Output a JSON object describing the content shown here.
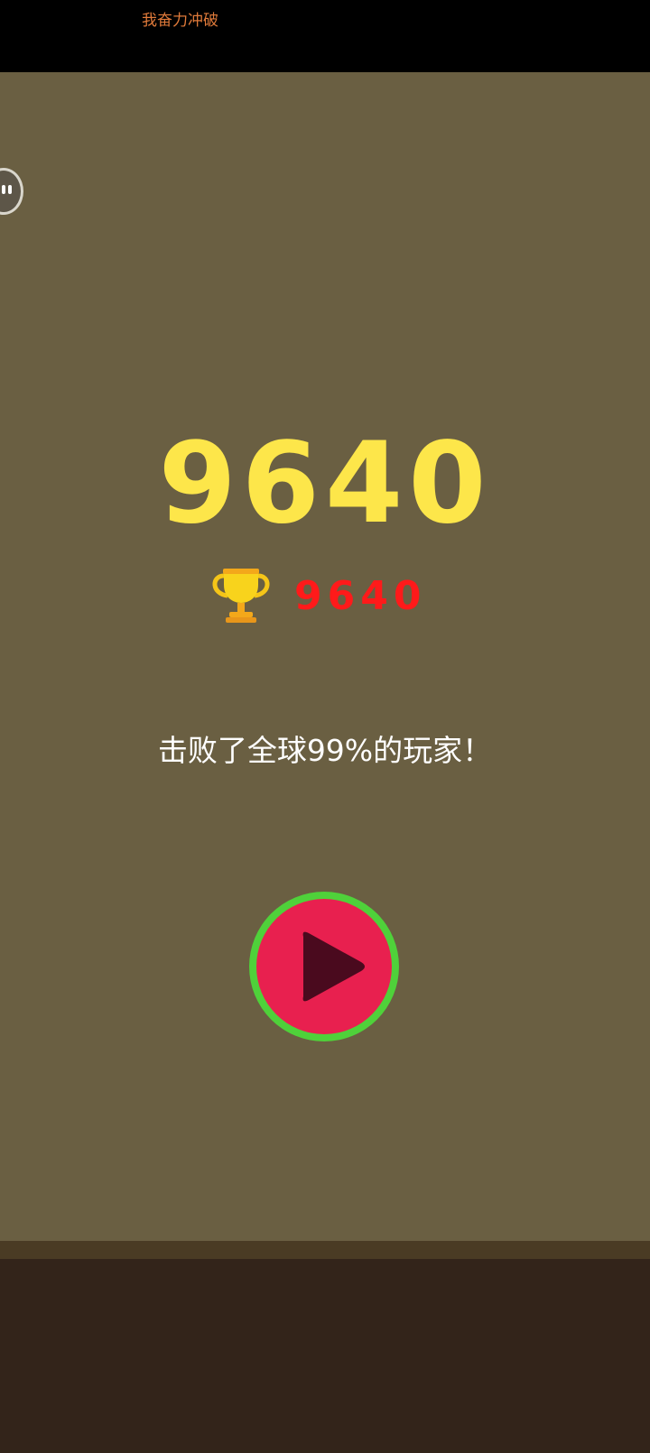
{
  "header": {
    "title": "我奋力冲破"
  },
  "game": {
    "score": "9640",
    "best_score": "9640",
    "beat_message": "击败了全球99%的玩家！"
  },
  "icons": {
    "side_handle": "pause-handle-icon",
    "trophy": "trophy-icon",
    "play": "play-icon"
  },
  "colors": {
    "score": "#fde64a",
    "best_score": "#ff1a1a",
    "play_ring": "#4fd13a",
    "play_fill": "#e8204f"
  }
}
